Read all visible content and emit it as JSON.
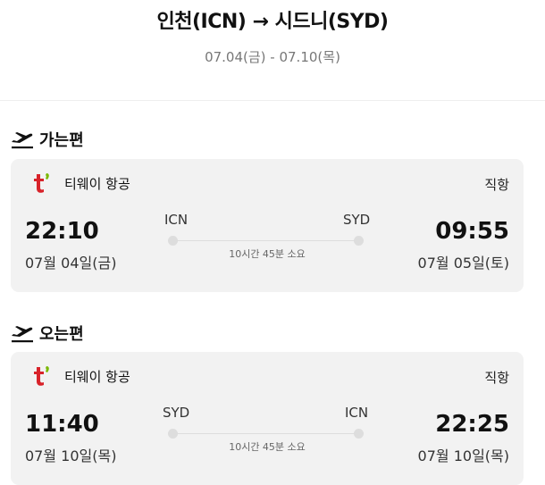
{
  "header": {
    "route": "인천(ICN) → 시드니(SYD)",
    "dates": "07.04(금) - 07.10(목)"
  },
  "outbound": {
    "section_title": "가는편",
    "airline": "티웨이 항공",
    "direct": "직항",
    "dep_time": "22:10",
    "dep_date": "07월 04일(금)",
    "from_code": "ICN",
    "to_code": "SYD",
    "duration": "10시간 45분 소요",
    "arr_time": "09:55",
    "arr_date": "07월 05일(토)"
  },
  "inbound": {
    "section_title": "오는편",
    "airline": "티웨이 항공",
    "direct": "직항",
    "dep_time": "11:40",
    "dep_date": "07월 10일(목)",
    "from_code": "SYD",
    "to_code": "ICN",
    "duration": "10시간 45분 소요",
    "arr_time": "22:25",
    "arr_date": "07월 10일(목)"
  },
  "icons": {
    "section": "plane-departure-icon",
    "airline_logo": "tway-logo-icon"
  },
  "colors": {
    "brand": "#d8232a",
    "card_bg": "#f2f2f2"
  }
}
